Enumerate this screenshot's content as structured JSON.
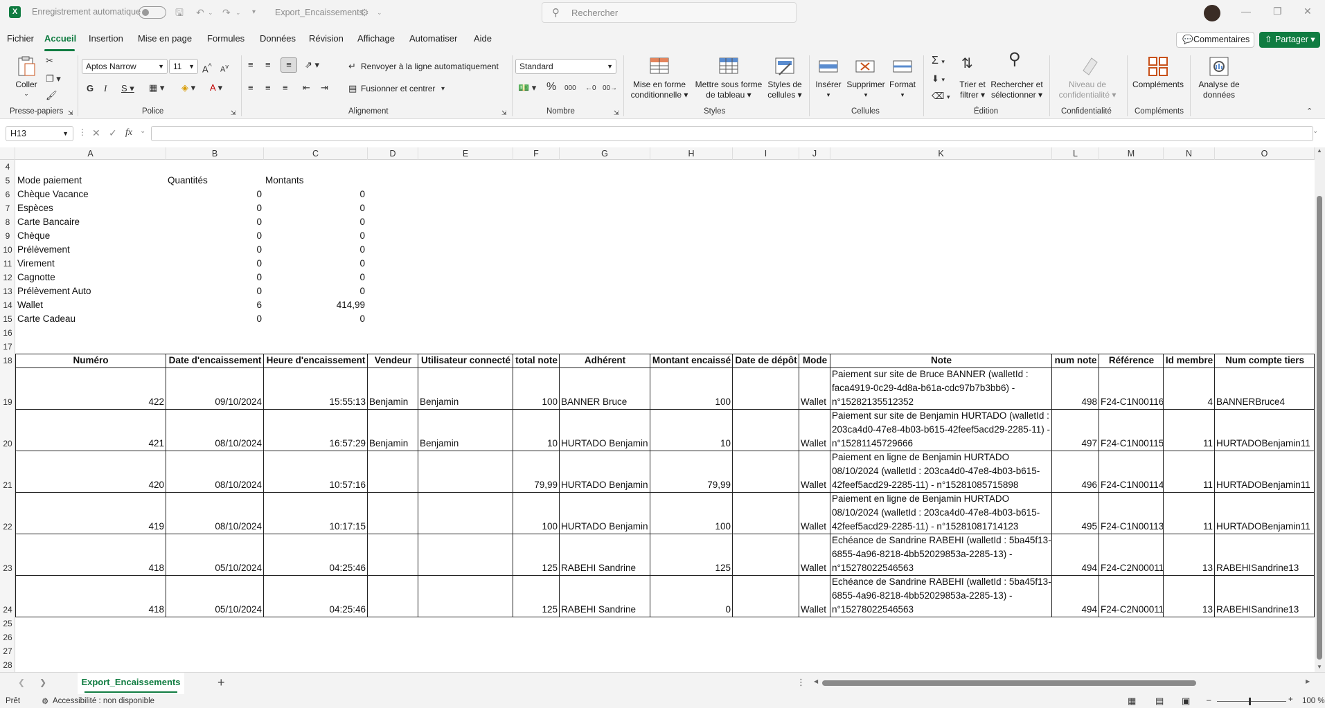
{
  "titlebar": {
    "autosave_label": "Enregistrement automatique",
    "filename": "Export_Encaissements",
    "search_placeholder": "Rechercher"
  },
  "menu": {
    "items": [
      "Fichier",
      "Accueil",
      "Insertion",
      "Mise en page",
      "Formules",
      "Données",
      "Révision",
      "Affichage",
      "Automatiser",
      "Aide"
    ],
    "active": "Accueil",
    "comments": "Commentaires",
    "share": "Partager"
  },
  "ribbon": {
    "clipboard": {
      "paste": "Coller",
      "group": "Presse-papiers"
    },
    "font": {
      "name": "Aptos Narrow",
      "size": "11",
      "group": "Police"
    },
    "alignment": {
      "wrap": "Renvoyer à la ligne automatiquement",
      "merge": "Fusionner et centrer",
      "group": "Alignement"
    },
    "number": {
      "format": "Standard",
      "group": "Nombre"
    },
    "styles": {
      "conditional": [
        "Mise en forme",
        "conditionnelle"
      ],
      "table": [
        "Mettre sous forme",
        "de tableau"
      ],
      "cell": [
        "Styles de",
        "cellules"
      ],
      "group": "Styles"
    },
    "cells": {
      "insert": "Insérer",
      "delete": "Supprimer",
      "format": "Format",
      "group": "Cellules"
    },
    "editing": {
      "sort": [
        "Trier et",
        "filtrer"
      ],
      "find": [
        "Rechercher et",
        "sélectionner"
      ],
      "group": "Édition"
    },
    "privacy": {
      "level": [
        "Niveau de",
        "confidentialité"
      ],
      "group": "Confidentialité"
    },
    "addins": {
      "label": "Compléments",
      "group": "Compléments"
    },
    "analysis": {
      "label": [
        "Analyse de",
        "données"
      ]
    }
  },
  "formula_bar": {
    "namebox": "H13",
    "formula": ""
  },
  "columns": [
    "A",
    "B",
    "C",
    "D",
    "E",
    "F",
    "G",
    "H",
    "I",
    "J",
    "K",
    "L",
    "M",
    "N",
    "O"
  ],
  "row_numbers": [
    "4",
    "5",
    "6",
    "7",
    "8",
    "9",
    "10",
    "11",
    "12",
    "13",
    "14",
    "15",
    "16",
    "17",
    "18",
    "19",
    "20",
    "21",
    "22",
    "23",
    "24",
    "25",
    "26",
    "27",
    "28"
  ],
  "summary": {
    "headers": [
      "Mode paiement",
      "Quantités",
      "Montants"
    ],
    "rows": [
      [
        "Chèque Vacance",
        "0",
        "0"
      ],
      [
        "Espèces",
        "0",
        "0"
      ],
      [
        "Carte Bancaire",
        "0",
        "0"
      ],
      [
        "Chèque",
        "0",
        "0"
      ],
      [
        "Prélèvement",
        "0",
        "0"
      ],
      [
        "Virement",
        "0",
        "0"
      ],
      [
        "Cagnotte",
        "0",
        "0"
      ],
      [
        "Prélèvement Auto",
        "0",
        "0"
      ],
      [
        "Wallet",
        "6",
        "414,99"
      ],
      [
        "Carte Cadeau",
        "0",
        "0"
      ]
    ]
  },
  "table": {
    "headers": [
      "Numéro",
      "Date d'encaissement",
      "Heure d'encaissement",
      "Vendeur",
      "Utilisateur connecté",
      "total note",
      "Adhérent",
      "Montant encaissé",
      "Date de dépôt",
      "Mode",
      "Note",
      "num note",
      "Référence",
      "Id membre",
      "Num compte tiers"
    ],
    "rows": [
      {
        "cells": [
          "422",
          "09/10/2024",
          "15:55:13",
          "Benjamin",
          "Benjamin",
          "100",
          "BANNER Bruce",
          "100",
          "",
          "Wallet",
          "",
          "498",
          "F24-C1N00116",
          "4",
          "BANNERBruce4"
        ],
        "note": [
          "Paiement sur site de Bruce BANNER (walletId :",
          "faca4919-0c29-4d8a-b61a-cdc97b7b3bb6) -",
          "n°15282135512352"
        ]
      },
      {
        "cells": [
          "421",
          "08/10/2024",
          "16:57:29",
          "Benjamin",
          "Benjamin",
          "10",
          "HURTADO Benjamin",
          "10",
          "",
          "Wallet",
          "",
          "497",
          "F24-C1N00115",
          "11",
          "HURTADOBenjamin11"
        ],
        "note": [
          "Paiement sur site de Benjamin HURTADO (walletId :",
          "203ca4d0-47e8-4b03-b615-42feef5acd29-2285-11) -",
          "n°15281145729666"
        ]
      },
      {
        "cells": [
          "420",
          "08/10/2024",
          "10:57:16",
          "",
          "",
          "79,99",
          "HURTADO Benjamin",
          "79,99",
          "",
          "Wallet",
          "",
          "496",
          "F24-C1N00114",
          "11",
          "HURTADOBenjamin11"
        ],
        "note": [
          "Paiement en ligne de Benjamin HURTADO",
          "08/10/2024 (walletId : 203ca4d0-47e8-4b03-b615-",
          "42feef5acd29-2285-11) - n°15281085715898"
        ]
      },
      {
        "cells": [
          "419",
          "08/10/2024",
          "10:17:15",
          "",
          "",
          "100",
          "HURTADO Benjamin",
          "100",
          "",
          "Wallet",
          "",
          "495",
          "F24-C1N00113",
          "11",
          "HURTADOBenjamin11"
        ],
        "note": [
          "Paiement en ligne de Benjamin HURTADO",
          "08/10/2024 (walletId : 203ca4d0-47e8-4b03-b615-",
          "42feef5acd29-2285-11) - n°15281081714123"
        ]
      },
      {
        "cells": [
          "418",
          "05/10/2024",
          "04:25:46",
          "",
          "",
          "125",
          "RABEHI Sandrine",
          "125",
          "",
          "Wallet",
          "",
          "494",
          "F24-C2N00011",
          "13",
          "RABEHISandrine13"
        ],
        "note": [
          "Echéance de Sandrine RABEHI (walletId : 5ba45f13-",
          "6855-4a96-8218-4bb52029853a-2285-13) -",
          "n°15278022546563"
        ]
      },
      {
        "cells": [
          "418",
          "05/10/2024",
          "04:25:46",
          "",
          "",
          "125",
          "RABEHI Sandrine",
          "0",
          "",
          "Wallet",
          "",
          "494",
          "F24-C2N00011",
          "13",
          "RABEHISandrine13"
        ],
        "note": [
          "Echéance de Sandrine RABEHI (walletId : 5ba45f13-",
          "6855-4a96-8218-4bb52029853a-2285-13) -",
          "n°15278022546563"
        ]
      }
    ]
  },
  "sheet_tab": "Export_Encaissements",
  "status": {
    "ready": "Prêt",
    "accessibility": "Accessibilité : non disponible",
    "zoom": "100 %"
  },
  "colors": {
    "accent": "#107c41"
  }
}
